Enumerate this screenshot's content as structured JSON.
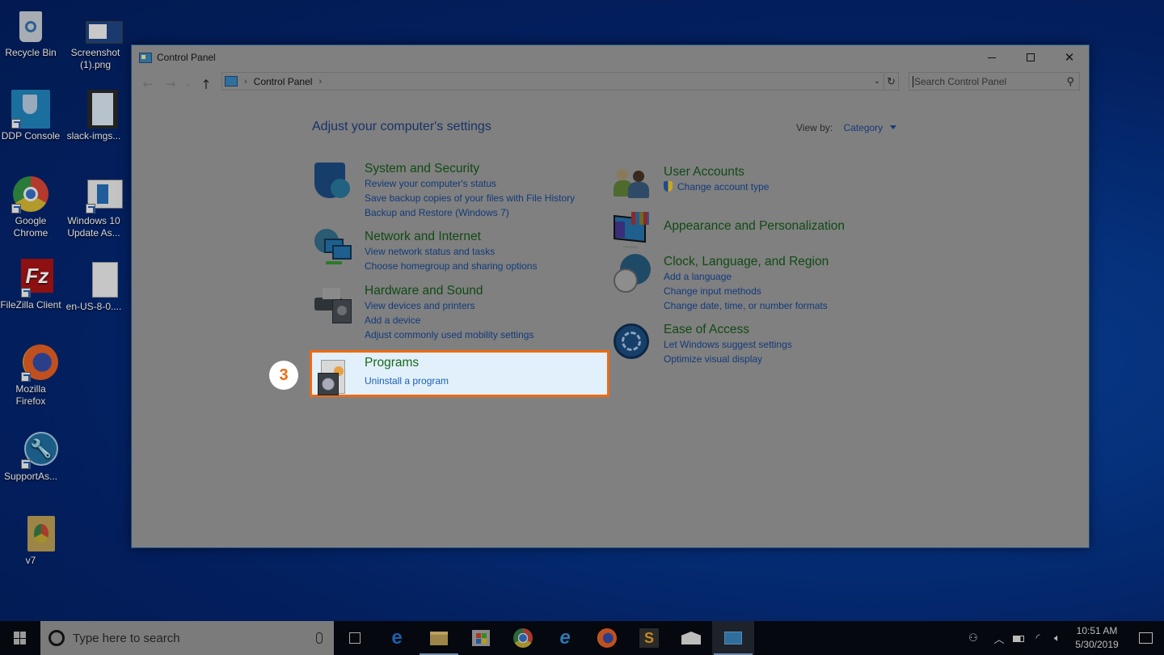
{
  "desktop": {
    "icons": [
      {
        "name": "recycle-bin",
        "label": "Recycle Bin"
      },
      {
        "name": "screenshot-png",
        "label": "Screenshot (1).png"
      },
      {
        "name": "ddp-console",
        "label": "DDP Console"
      },
      {
        "name": "slack-imgs",
        "label": "slack-imgs..."
      },
      {
        "name": "google-chrome",
        "label": "Google Chrome"
      },
      {
        "name": "windows10-update",
        "label": "Windows 10 Update As..."
      },
      {
        "name": "filezilla",
        "label": "FileZilla Client"
      },
      {
        "name": "en-us-file",
        "label": "en-US-8-0...."
      },
      {
        "name": "mozilla-firefox",
        "label": "Mozilla Firefox"
      },
      {
        "name": "supportassist",
        "label": "SupportAs..."
      },
      {
        "name": "v7-folder",
        "label": "v7"
      }
    ]
  },
  "window": {
    "title": "Control Panel",
    "controls": {
      "minimize": "minimize",
      "maximize": "maximize",
      "close": "✕"
    },
    "nav": {
      "back": "←",
      "forward": "→",
      "recent": "⌄",
      "up": "↑"
    },
    "address": {
      "breadcrumb": [
        "Control Panel"
      ],
      "separator": "›"
    },
    "search": {
      "placeholder": "Search Control Panel",
      "value": ""
    },
    "heading": "Adjust your computer's settings",
    "view_by": {
      "label": "View by:",
      "value": "Category"
    },
    "categories_left": [
      {
        "title": "System and Security",
        "icon": "shield-icon",
        "links": [
          "Review your computer's status",
          "Save backup copies of your files with File History",
          "Backup and Restore (Windows 7)"
        ]
      },
      {
        "title": "Network and Internet",
        "icon": "network-icon",
        "links": [
          "View network status and tasks",
          "Choose homegroup and sharing options"
        ]
      },
      {
        "title": "Hardware and Sound",
        "icon": "printer-icon",
        "links": [
          "View devices and printers",
          "Add a device",
          "Adjust commonly used mobility settings"
        ]
      },
      {
        "title": "Programs",
        "icon": "programs-icon",
        "links": [
          "Uninstall a program"
        ],
        "highlighted": true
      }
    ],
    "categories_right": [
      {
        "title": "User Accounts",
        "icon": "users-icon",
        "links": [
          "Change account type"
        ]
      },
      {
        "title": "Appearance and Personalization",
        "icon": "monitor-icon",
        "links": []
      },
      {
        "title": "Clock, Language, and Region",
        "icon": "globe-clock-icon",
        "links": [
          "Add a language",
          "Change input methods",
          "Change date, time, or number formats"
        ]
      },
      {
        "title": "Ease of Access",
        "icon": "ease-of-access-icon",
        "links": [
          "Let Windows suggest settings",
          "Optimize visual display"
        ]
      }
    ]
  },
  "annotation": {
    "step": "3",
    "color": "#f06a12"
  },
  "taskbar": {
    "search_placeholder": "Type here to search",
    "apps": [
      "task-view",
      "edge",
      "file-explorer",
      "store",
      "chrome",
      "internet-explorer",
      "firefox",
      "sublime-text",
      "mail",
      "control-panel"
    ],
    "clock": {
      "time": "10:51 AM",
      "date": "5/30/2019"
    }
  }
}
